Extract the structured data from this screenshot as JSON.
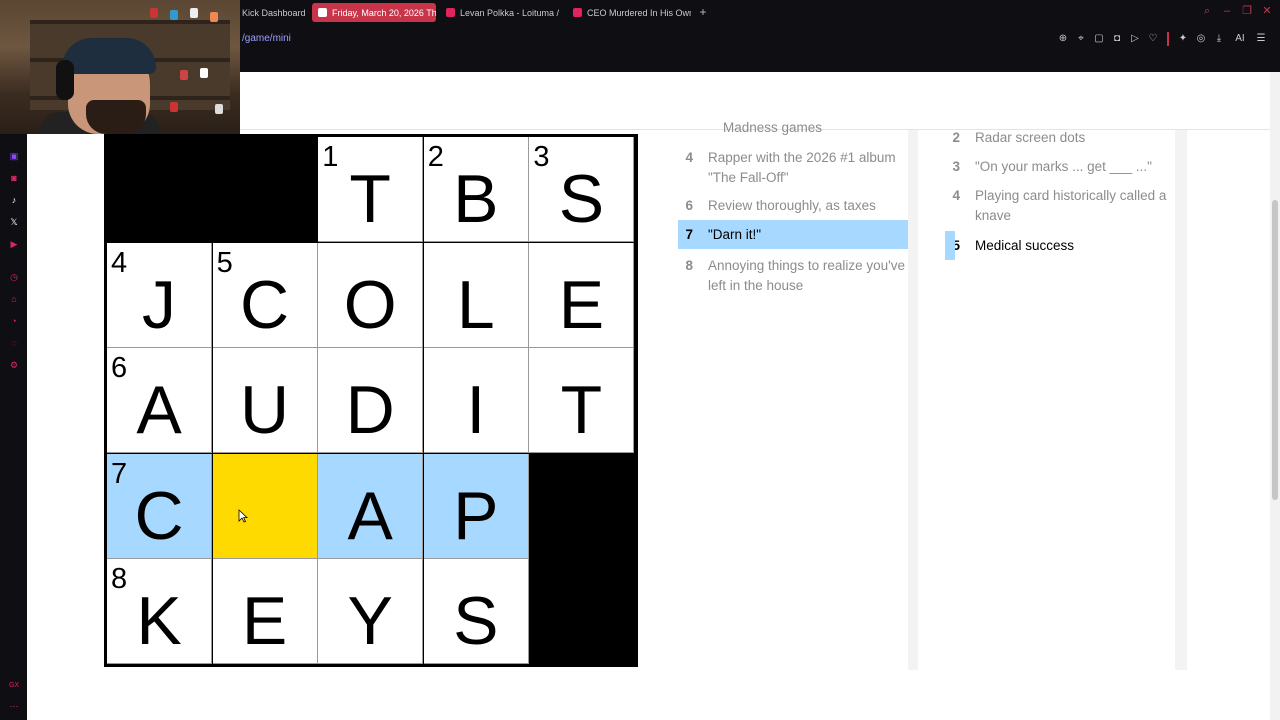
{
  "browser": {
    "tabs": [
      {
        "label": "Kick Dashboard",
        "favicon": "kick-icon"
      },
      {
        "label": "Friday, March 20, 2026 Th",
        "favicon": "nyt-icon"
      },
      {
        "label": "Levan Polkka - Loituma / I",
        "favicon": "youtube-icon"
      },
      {
        "label": "CEO Murdered In His Own",
        "favicon": "youtube-icon"
      }
    ],
    "url": "/game/mini",
    "toolbar_icons": [
      "zoom-icon",
      "bookmark-icon",
      "snapshot-icon",
      "shield-icon",
      "play-icon",
      "heart-icon",
      "extensions-icon",
      "account-icon",
      "download-icon",
      "ai-icon",
      "menu-icon"
    ],
    "ai_label": "AI"
  },
  "sidebar_icons": [
    "twitch-icon",
    "instagram-icon",
    "tiktok-icon",
    "x-icon",
    "youtube-icon",
    "history-icon",
    "pin-icon",
    "clock-icon",
    "chat-icon",
    "settings-icon",
    "gx-icon",
    "more-icon"
  ],
  "gx_label": "GX",
  "grid": {
    "rows": [
      [
        {
          "type": "black"
        },
        {
          "type": "black"
        },
        {
          "num": "1",
          "letter": "T"
        },
        {
          "num": "2",
          "letter": "B"
        },
        {
          "num": "3",
          "letter": "S"
        }
      ],
      [
        {
          "num": "4",
          "letter": "J"
        },
        {
          "num": "5",
          "letter": "C"
        },
        {
          "letter": "O"
        },
        {
          "letter": "L"
        },
        {
          "letter": "E"
        }
      ],
      [
        {
          "num": "6",
          "letter": "A"
        },
        {
          "letter": "U"
        },
        {
          "letter": "D"
        },
        {
          "letter": "I"
        },
        {
          "letter": "T"
        }
      ],
      [
        {
          "num": "7",
          "letter": "C",
          "state": "hl"
        },
        {
          "letter": "",
          "state": "sel"
        },
        {
          "letter": "A",
          "state": "hl"
        },
        {
          "letter": "P",
          "state": "hl"
        },
        {
          "type": "black"
        }
      ],
      [
        {
          "num": "8",
          "letter": "K"
        },
        {
          "letter": "E"
        },
        {
          "letter": "Y"
        },
        {
          "letter": "S"
        },
        {
          "type": "black"
        }
      ]
    ]
  },
  "across": {
    "partial_text": "Madness games",
    "clues": [
      {
        "num": "4",
        "text": "Rapper with the 2026 #1 album \"The Fall-Off\""
      },
      {
        "num": "6",
        "text": "Review thoroughly, as taxes"
      },
      {
        "num": "7",
        "text": "\"Darn it!\"",
        "state": "active"
      },
      {
        "num": "8",
        "text": "Annoying things to realize you've left in the house"
      }
    ]
  },
  "down": {
    "clues": [
      {
        "num": "2",
        "text": "Radar screen dots"
      },
      {
        "num": "3",
        "text": "\"On your marks ... get ___ ...\""
      },
      {
        "num": "4",
        "text": "Playing card historically called a knave"
      },
      {
        "num": "5",
        "text": "Medical success",
        "state": "cross"
      }
    ]
  },
  "colors": {
    "highlight": "#a7d8ff",
    "selected": "#ffda00",
    "browser_accent": "#c8354b"
  }
}
